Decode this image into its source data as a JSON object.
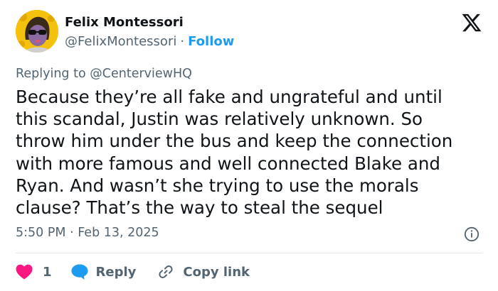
{
  "author": {
    "name": "Felix Montessori",
    "handle": "@FelixMontessori",
    "separator": "·",
    "follow_label": "Follow"
  },
  "reply_context": {
    "prefix": "Replying to",
    "target": "@CenterviewHQ"
  },
  "post": {
    "lines": [
      "Because they’re all fake and ungrateful and until",
      "this scandal, Justin was relatively unknown. So",
      "throw him under the bus and keep the connection",
      "with more famous and well connected Blake and",
      "Ryan. And wasn’t she trying to use the morals",
      "clause? That’s the way to steal the sequel"
    ],
    "timestamp": "5:50 PM · Feb 13, 2025"
  },
  "actions": {
    "like_count": "1",
    "reply_label": "Reply",
    "copy_label": "Copy link"
  },
  "icons": {
    "brand": "x-logo-icon",
    "info": "info-icon",
    "like": "heart-icon",
    "reply": "speech-bubble-icon",
    "copy": "link-icon"
  },
  "colors": {
    "accent": "#1d9bf0",
    "heart": "#f91880",
    "text": "#0f1419",
    "secondary": "#536471",
    "avatar_bg": "#f4c20d"
  }
}
